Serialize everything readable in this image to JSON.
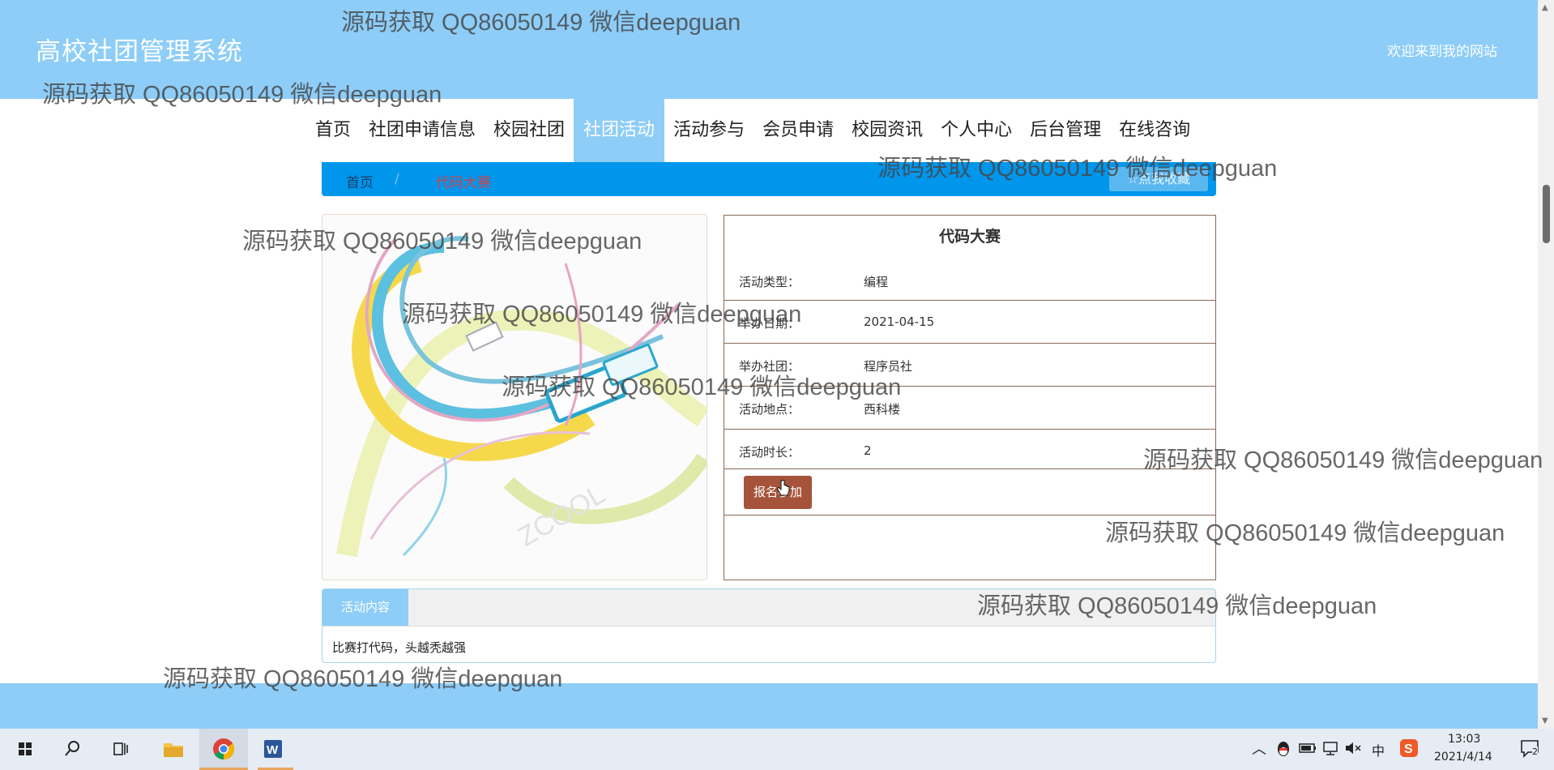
{
  "header": {
    "site_title": "高校社团管理系统",
    "welcome": "欢迎来到我的网站"
  },
  "nav": {
    "items": [
      "首页",
      "社团申请信息",
      "校园社团",
      "社团活动",
      "活动参与",
      "会员申请",
      "校园资讯",
      "个人中心",
      "后台管理",
      "在线咨询"
    ],
    "active": "社团活动"
  },
  "breadcrumb": {
    "home": "首页",
    "separator": "/",
    "current": "代码大赛",
    "favorite_button": "☆点我收藏"
  },
  "detail": {
    "title": "代码大赛",
    "fields": [
      {
        "label": "活动类型：",
        "value": "编程"
      },
      {
        "label": "举办日期：",
        "value": "2021-04-15"
      },
      {
        "label": "举办社团：",
        "value": "程序员社"
      },
      {
        "label": "活动地点：",
        "value": "西科楼"
      },
      {
        "label": "活动时长：",
        "value": "2"
      }
    ],
    "join_button": "报名参加"
  },
  "content": {
    "tab_label": "活动内容",
    "text": "比赛打代码，头越秃越强"
  },
  "watermark": "源码获取 QQ86050149 微信deepguan",
  "taskbar": {
    "ime": "中",
    "time": "13:03",
    "date": "2021/4/14",
    "notification_count": "2"
  },
  "colors": {
    "header_bg": "#8dcdf8",
    "breadcrumb_bg": "#0096ec",
    "join_button": "#a6533b",
    "detail_border": "#8b6b55"
  }
}
